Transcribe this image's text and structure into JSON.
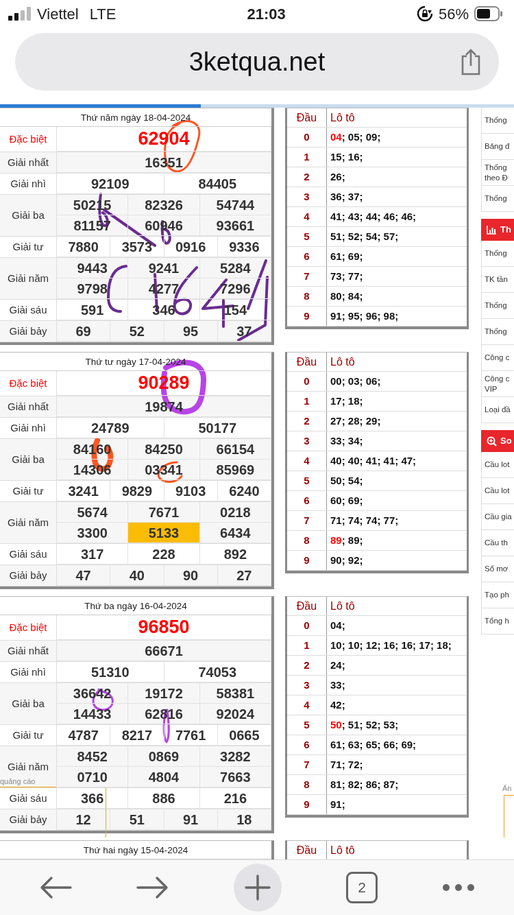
{
  "status_bar": {
    "carrier": "Viettel",
    "network": "LTE",
    "time": "21:03",
    "battery": "56%"
  },
  "address_bar": {
    "url": "3ketqua.net"
  },
  "page_load": {
    "level": 0.39
  },
  "days": [
    {
      "title": "Thứ năm ngày 18-04-2024",
      "prizes": [
        {
          "kind": "special",
          "label": "Đặc biệt",
          "numbers": [
            {
              "value": "62904",
              "highlighted": false
            }
          ]
        },
        {
          "kind": "first",
          "label": "Giải nhất",
          "numbers": [
            {
              "value": "16351",
              "highlighted": false
            }
          ]
        },
        {
          "kind": "second",
          "label": "Giải nhì",
          "numbers": [
            {
              "value": "92109",
              "highlighted": false
            },
            {
              "value": "84405",
              "highlighted": false
            }
          ]
        },
        {
          "kind": "third",
          "label": "Giải ba",
          "numbers": [
            {
              "value": "50215",
              "highlighted": false
            },
            {
              "value": "82326",
              "highlighted": false
            },
            {
              "value": "54744",
              "highlighted": false
            },
            {
              "value": "81157",
              "highlighted": false
            },
            {
              "value": "60946",
              "highlighted": false
            },
            {
              "value": "93661",
              "highlighted": false
            }
          ]
        },
        {
          "kind": "fourth",
          "label": "Giải tư",
          "numbers": [
            {
              "value": "7880",
              "highlighted": false
            },
            {
              "value": "3573",
              "highlighted": false
            },
            {
              "value": "0916",
              "highlighted": false
            },
            {
              "value": "9336",
              "highlighted": false
            }
          ]
        },
        {
          "kind": "fifth",
          "label": "Giải năm",
          "numbers": [
            {
              "value": "9443",
              "highlighted": false
            },
            {
              "value": "9241",
              "highlighted": false
            },
            {
              "value": "5284",
              "highlighted": false
            },
            {
              "value": "9798",
              "highlighted": false
            },
            {
              "value": "4277",
              "highlighted": false
            },
            {
              "value": "7296",
              "highlighted": false
            }
          ]
        },
        {
          "kind": "sixth",
          "label": "Giải sáu",
          "numbers": [
            {
              "value": "591",
              "highlighted": false
            },
            {
              "value": "346",
              "highlighted": false
            },
            {
              "value": "154",
              "highlighted": false
            }
          ]
        },
        {
          "kind": "seventh",
          "label": "Giải bảy",
          "numbers": [
            {
              "value": "69",
              "highlighted": false
            },
            {
              "value": "52",
              "highlighted": false
            },
            {
              "value": "95",
              "highlighted": false
            },
            {
              "value": "37",
              "highlighted": false
            }
          ]
        }
      ],
      "handwriting": [
        {
          "kind": "circle",
          "color": "#ff5522"
        },
        {
          "kind": "scribble",
          "color": "#6a2c91"
        }
      ],
      "loto": {
        "columns": [
          "Đầu",
          "Lô tô"
        ],
        "rows": [
          {
            "head": "0",
            "numbers": [
              {
                "value": "04",
                "special": true
              },
              {
                "value": "; 05; 09;",
                "special": false
              }
            ]
          },
          {
            "head": "1",
            "numbers": [
              {
                "value": "15; 16;",
                "special": false
              }
            ]
          },
          {
            "head": "2",
            "numbers": [
              {
                "value": "26;",
                "special": false
              }
            ]
          },
          {
            "head": "3",
            "numbers": [
              {
                "value": "36; 37;",
                "special": false
              }
            ]
          },
          {
            "head": "4",
            "numbers": [
              {
                "value": "41; 43; 44; 46; 46;",
                "special": false
              }
            ]
          },
          {
            "head": "5",
            "numbers": [
              {
                "value": "51; 52; 54; 57;",
                "special": false
              }
            ]
          },
          {
            "head": "6",
            "numbers": [
              {
                "value": "61; 69;",
                "special": false
              }
            ]
          },
          {
            "head": "7",
            "numbers": [
              {
                "value": "73; 77;",
                "special": false
              }
            ]
          },
          {
            "head": "8",
            "numbers": [
              {
                "value": "80; 84;",
                "special": false
              }
            ]
          },
          {
            "head": "9",
            "numbers": [
              {
                "value": "91; 95; 96; 98;",
                "special": false
              }
            ]
          }
        ]
      }
    },
    {
      "title": "Thứ tư ngày 17-04-2024",
      "prizes": [
        {
          "kind": "special",
          "label": "Đặc biệt",
          "numbers": [
            {
              "value": "90289",
              "highlighted": false
            }
          ]
        },
        {
          "kind": "first",
          "label": "Giải nhất",
          "numbers": [
            {
              "value": "19874",
              "highlighted": false
            }
          ]
        },
        {
          "kind": "second",
          "label": "Giải nhì",
          "numbers": [
            {
              "value": "24789",
              "highlighted": false
            },
            {
              "value": "50177",
              "highlighted": false
            }
          ]
        },
        {
          "kind": "third",
          "label": "Giải ba",
          "numbers": [
            {
              "value": "84160",
              "highlighted": false
            },
            {
              "value": "84250",
              "highlighted": false
            },
            {
              "value": "66154",
              "highlighted": false
            },
            {
              "value": "14306",
              "highlighted": false
            },
            {
              "value": "03341",
              "highlighted": false
            },
            {
              "value": "85969",
              "highlighted": false
            }
          ]
        },
        {
          "kind": "fourth",
          "label": "Giải tư",
          "numbers": [
            {
              "value": "3241",
              "highlighted": false
            },
            {
              "value": "9829",
              "highlighted": false
            },
            {
              "value": "9103",
              "highlighted": false
            },
            {
              "value": "6240",
              "highlighted": false
            }
          ]
        },
        {
          "kind": "fifth",
          "label": "Giải năm",
          "numbers": [
            {
              "value": "5674",
              "highlighted": false
            },
            {
              "value": "7671",
              "highlighted": false
            },
            {
              "value": "0218",
              "highlighted": false
            },
            {
              "value": "3300",
              "highlighted": false
            },
            {
              "value": "5133",
              "highlighted": true
            },
            {
              "value": "6434",
              "highlighted": false
            }
          ]
        },
        {
          "kind": "sixth",
          "label": "Giải sáu",
          "numbers": [
            {
              "value": "317",
              "highlighted": false
            },
            {
              "value": "228",
              "highlighted": false
            },
            {
              "value": "892",
              "highlighted": false
            }
          ]
        },
        {
          "kind": "seventh",
          "label": "Giải bảy",
          "numbers": [
            {
              "value": "47",
              "highlighted": false
            },
            {
              "value": "40",
              "highlighted": false
            },
            {
              "value": "90",
              "highlighted": false
            },
            {
              "value": "27",
              "highlighted": false
            }
          ]
        }
      ],
      "handwriting": [
        {
          "kind": "circle",
          "color": "#b844e8"
        },
        {
          "kind": "circle",
          "color": "#ff5522"
        },
        {
          "kind": "scribble",
          "color": "#ff5522"
        }
      ],
      "loto": {
        "columns": [
          "Đầu",
          "Lô tô"
        ],
        "rows": [
          {
            "head": "0",
            "numbers": [
              {
                "value": "00; 03; 06;",
                "special": false
              }
            ]
          },
          {
            "head": "1",
            "numbers": [
              {
                "value": "17; 18;",
                "special": false
              }
            ]
          },
          {
            "head": "2",
            "numbers": [
              {
                "value": "27; 28; 29;",
                "special": false
              }
            ]
          },
          {
            "head": "3",
            "numbers": [
              {
                "value": "33; 34;",
                "special": false
              }
            ]
          },
          {
            "head": "4",
            "numbers": [
              {
                "value": "40; 40; 41; 41; 47;",
                "special": false
              }
            ]
          },
          {
            "head": "5",
            "numbers": [
              {
                "value": "50; 54;",
                "special": false
              }
            ]
          },
          {
            "head": "6",
            "numbers": [
              {
                "value": "60; 69;",
                "special": false
              }
            ]
          },
          {
            "head": "7",
            "numbers": [
              {
                "value": "71; 74; 74; 77;",
                "special": false
              }
            ]
          },
          {
            "head": "8",
            "numbers": [
              {
                "value": "89",
                "special": true
              },
              {
                "value": "; 89;",
                "special": false
              }
            ]
          },
          {
            "head": "9",
            "numbers": [
              {
                "value": "90; 92;",
                "special": false
              }
            ]
          }
        ]
      }
    },
    {
      "title": "Thứ ba ngày 16-04-2024",
      "prizes": [
        {
          "kind": "special",
          "label": "Đặc biệt",
          "numbers": [
            {
              "value": "96850",
              "highlighted": false
            }
          ]
        },
        {
          "kind": "first",
          "label": "Giải nhất",
          "numbers": [
            {
              "value": "66671",
              "highlighted": false
            }
          ]
        },
        {
          "kind": "second",
          "label": "Giải nhì",
          "numbers": [
            {
              "value": "51310",
              "highlighted": false
            },
            {
              "value": "74053",
              "highlighted": false
            }
          ]
        },
        {
          "kind": "third",
          "label": "Giải ba",
          "numbers": [
            {
              "value": "36642",
              "highlighted": false
            },
            {
              "value": "19172",
              "highlighted": false
            },
            {
              "value": "58381",
              "highlighted": false
            },
            {
              "value": "14433",
              "highlighted": false
            },
            {
              "value": "62816",
              "highlighted": false
            },
            {
              "value": "92024",
              "highlighted": false
            }
          ]
        },
        {
          "kind": "fourth",
          "label": "Giải tư",
          "numbers": [
            {
              "value": "4787",
              "highlighted": false
            },
            {
              "value": "8217",
              "highlighted": false
            },
            {
              "value": "7761",
              "highlighted": false
            },
            {
              "value": "0665",
              "highlighted": false
            }
          ]
        },
        {
          "kind": "fifth",
          "label": "Giải năm",
          "numbers": [
            {
              "value": "8452",
              "highlighted": false
            },
            {
              "value": "0869",
              "highlighted": false
            },
            {
              "value": "3282",
              "highlighted": false
            },
            {
              "value": "0710",
              "highlighted": false
            },
            {
              "value": "4804",
              "highlighted": false
            },
            {
              "value": "7663",
              "highlighted": false
            }
          ]
        },
        {
          "kind": "sixth",
          "label": "Giải sáu",
          "numbers": [
            {
              "value": "366",
              "highlighted": false
            },
            {
              "value": "886",
              "highlighted": false
            },
            {
              "value": "216",
              "highlighted": false
            }
          ]
        },
        {
          "kind": "seventh",
          "label": "Giải bảy",
          "numbers": [
            {
              "value": "12",
              "highlighted": false
            },
            {
              "value": "51",
              "highlighted": false
            },
            {
              "value": "91",
              "highlighted": false
            },
            {
              "value": "18",
              "highlighted": false
            }
          ]
        }
      ],
      "handwriting": [
        {
          "kind": "circle",
          "color": "#b844e8"
        },
        {
          "kind": "scribble",
          "color": "#b844e8"
        }
      ],
      "loto": {
        "columns": [
          "Đầu",
          "Lô tô"
        ],
        "rows": [
          {
            "head": "0",
            "numbers": [
              {
                "value": "04;",
                "special": false
              }
            ]
          },
          {
            "head": "1",
            "numbers": [
              {
                "value": "10; 10; 12; 16; 16; 17; 18;",
                "special": false
              }
            ]
          },
          {
            "head": "2",
            "numbers": [
              {
                "value": "24;",
                "special": false
              }
            ]
          },
          {
            "head": "3",
            "numbers": [
              {
                "value": "33;",
                "special": false
              }
            ]
          },
          {
            "head": "4",
            "numbers": [
              {
                "value": "42;",
                "special": false
              }
            ]
          },
          {
            "head": "5",
            "numbers": [
              {
                "value": "50",
                "special": true
              },
              {
                "value": "; 51; 52; 53;",
                "special": false
              }
            ]
          },
          {
            "head": "6",
            "numbers": [
              {
                "value": "61; 63; 65; 66; 69;",
                "special": false
              }
            ]
          },
          {
            "head": "7",
            "numbers": [
              {
                "value": "71; 72;",
                "special": false
              }
            ]
          },
          {
            "head": "8",
            "numbers": [
              {
                "value": "81; 82; 86; 87;",
                "special": false
              }
            ]
          },
          {
            "head": "9",
            "numbers": [
              {
                "value": "91;",
                "special": false
              }
            ]
          }
        ]
      }
    },
    {
      "title": "Thứ hai ngày 15-04-2024",
      "loto": {
        "columns": [
          "Đầu",
          "Lô tô"
        ]
      }
    }
  ],
  "sidebar": {
    "groups": [
      {
        "items": [
          "Thống",
          "Bảng đ",
          "Thống\ntheo Đ",
          "Thống"
        ]
      },
      {
        "title": "Th",
        "kind": "chart",
        "items": [
          "Thống",
          "TK tần",
          "Thống",
          "Thống",
          "Công c",
          "Công c\nVIP",
          "Loại đầ"
        ]
      },
      {
        "title": "So",
        "kind": "search",
        "items": [
          "Cầu lot",
          "Cầu lot",
          "Cầu gia",
          "Cầu th",
          "Sổ mơ",
          "Tạo ph",
          "Tổng h"
        ]
      }
    ]
  },
  "ad_labels": [
    "quảng cáo",
    "Ẩn"
  ],
  "toolbar": {
    "tab_count": "2"
  }
}
